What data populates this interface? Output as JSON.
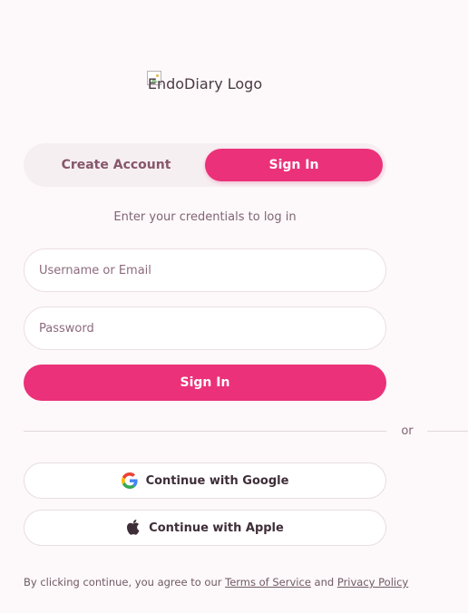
{
  "logo": {
    "alt_text": "EndoDiary Logo"
  },
  "auth_tabs": {
    "create_account_label": "Create Account",
    "sign_in_label": "Sign In",
    "active": "Sign In"
  },
  "subtitle": "Enter your credentials to log in",
  "form": {
    "username": {
      "placeholder": "Username or Email",
      "value": ""
    },
    "password": {
      "placeholder": "Password",
      "value": ""
    },
    "submit_label": "Sign In"
  },
  "divider": {
    "text": "or"
  },
  "social": {
    "google_label": "Continue with Google",
    "google_icon": "google-icon",
    "apple_label": "Continue with Apple",
    "apple_icon": "apple-icon"
  },
  "terms": {
    "prefix": "By clicking continue, you agree to our",
    "terms_link": "Terms of Service",
    "and_text": "and",
    "privacy_link": "Privacy Policy"
  },
  "colors": {
    "accent": "#ea3179",
    "background": "#fdf8f9",
    "tab_track": "#f6eff2"
  }
}
